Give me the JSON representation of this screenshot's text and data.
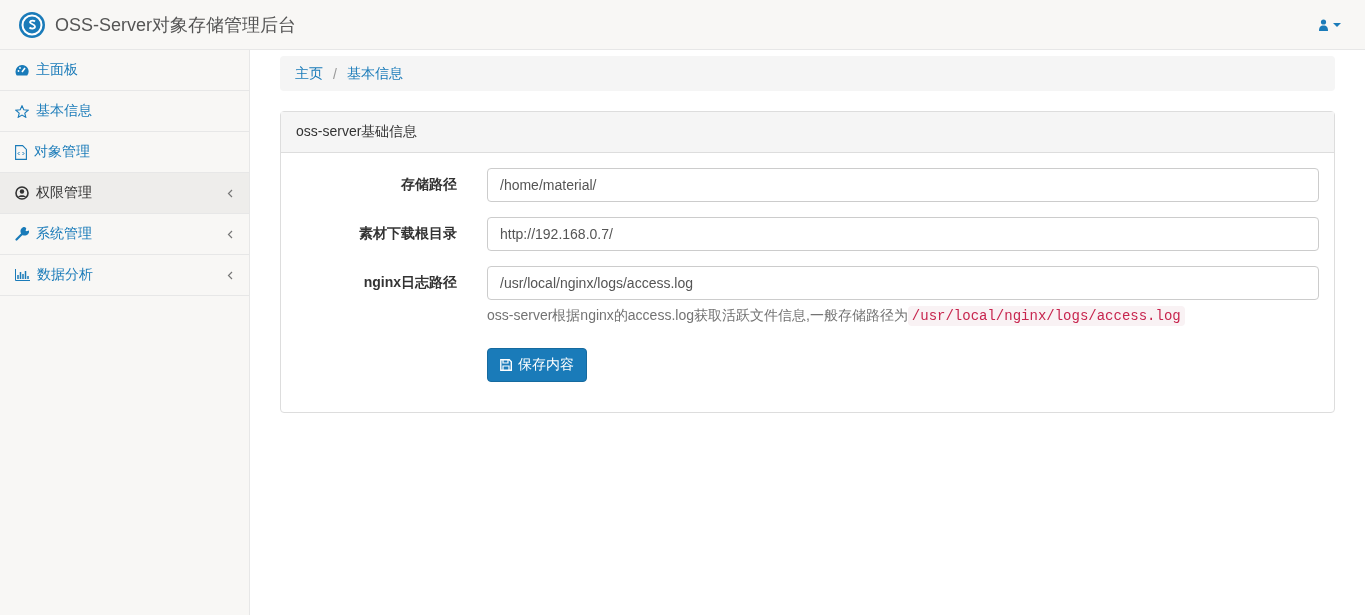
{
  "header": {
    "title": "OSS-Server对象存储管理后台"
  },
  "sidebar": {
    "items": [
      {
        "label": "主面板",
        "selected": false,
        "has_submenu": false
      },
      {
        "label": "基本信息",
        "selected": false,
        "has_submenu": false
      },
      {
        "label": "对象管理",
        "selected": false,
        "has_submenu": false
      },
      {
        "label": "权限管理",
        "selected": true,
        "has_submenu": true
      },
      {
        "label": "系统管理",
        "selected": false,
        "has_submenu": true
      },
      {
        "label": "数据分析",
        "selected": false,
        "has_submenu": true
      }
    ]
  },
  "breadcrumb": {
    "items": [
      "主页",
      "基本信息"
    ],
    "separator": "/"
  },
  "panel": {
    "title": "oss-server基础信息",
    "fields": [
      {
        "label": "存储路径",
        "value": "/home/material/"
      },
      {
        "label": "素材下载根目录",
        "value": "http://192.168.0.7/"
      },
      {
        "label": "nginx日志路径",
        "value": "/usr/local/nginx/logs/access.log"
      }
    ],
    "hint": {
      "text": "oss-server根据nginx的access.log获取活跃文件信息,一般存储路径为",
      "code": "/usr/local/nginx/logs/access.log"
    },
    "save_button": "保存内容"
  }
}
